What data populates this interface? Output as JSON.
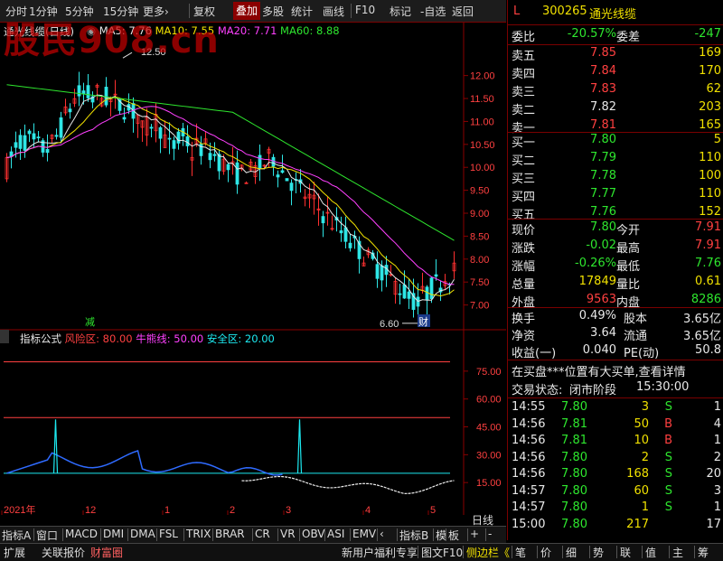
{
  "toolbar": {
    "items": [
      "分时",
      "1分钟",
      "5分钟",
      "15分钟",
      "更多›",
      "复权",
      "叠加",
      "多股",
      "统计",
      "画线",
      "F10",
      "标记",
      "-自选",
      "返回"
    ],
    "active": "叠加"
  },
  "watermark": "股民908.cn",
  "chart": {
    "title": "通光线缆(日线)",
    "ma": [
      {
        "label": "MA5:",
        "value": "7.76",
        "color": "#e8e8e8"
      },
      {
        "label": "MA10:",
        "value": "7.55",
        "color": "#f0e000"
      },
      {
        "label": "MA20:",
        "value": "7.71",
        "color": "#ff40ff"
      },
      {
        "label": "MA60:",
        "value": "8.88",
        "color": "#2ee62e"
      }
    ],
    "high_marker": "12.50",
    "low_marker": "6.60",
    "price_ticks": [
      "12.00",
      "11.50",
      "11.00",
      "10.50",
      "10.00",
      "9.50",
      "9.00",
      "8.50",
      "8.00",
      "7.50",
      "7.00"
    ],
    "reduce_marker": "减",
    "finance_marker": "财"
  },
  "chart_data": {
    "type": "candlestick",
    "price_ylim": [
      6.5,
      12.8
    ],
    "moving_averages": [
      {
        "name": "MA5",
        "value": 7.76
      },
      {
        "name": "MA10",
        "value": 7.55
      },
      {
        "name": "MA20",
        "value": 7.71
      },
      {
        "name": "MA60",
        "value": 8.88
      }
    ],
    "period_high": 12.5,
    "period_low": 6.6,
    "x_labels": [
      "2021年",
      "12",
      "1",
      "2",
      "3",
      "4",
      "5"
    ],
    "indicator": {
      "name": "指标公式",
      "params": [
        {
          "label": "风险区:",
          "value": "80.00"
        },
        {
          "label": "牛熊线:",
          "value": "50.00"
        },
        {
          "label": "安全区:",
          "value": "20.00"
        }
      ],
      "ticks": [
        "75.00",
        "60.00",
        "45.00",
        "30.00",
        "15.00"
      ],
      "ylim": [
        0,
        90
      ]
    }
  },
  "quote": {
    "flag": "L",
    "code": "300265",
    "name": "通光线缆",
    "weibi_label": "委比",
    "weibi": "-20.57%",
    "weicha_label": "委差",
    "weicha": "-247",
    "asks": [
      {
        "label": "卖五",
        "price": "7.85",
        "vol": "169"
      },
      {
        "label": "卖四",
        "price": "7.84",
        "vol": "170"
      },
      {
        "label": "卖三",
        "price": "7.83",
        "vol": "62"
      },
      {
        "label": "卖二",
        "price": "7.82",
        "vol": "203"
      },
      {
        "label": "卖一",
        "price": "7.81",
        "vol": "165"
      }
    ],
    "bids": [
      {
        "label": "买一",
        "price": "7.80",
        "vol": "5"
      },
      {
        "label": "买二",
        "price": "7.79",
        "vol": "110"
      },
      {
        "label": "买三",
        "price": "7.78",
        "vol": "100"
      },
      {
        "label": "买四",
        "price": "7.77",
        "vol": "110"
      },
      {
        "label": "买五",
        "price": "7.76",
        "vol": "152"
      }
    ],
    "stats": [
      {
        "l1": "现价",
        "v1": "7.80",
        "c1": "green",
        "l2": "今开",
        "v2": "7.91",
        "c2": "red"
      },
      {
        "l1": "涨跌",
        "v1": "-0.02",
        "c1": "green",
        "l2": "最高",
        "v2": "7.91",
        "c2": "red"
      },
      {
        "l1": "涨幅",
        "v1": "-0.26%",
        "c1": "green",
        "l2": "最低",
        "v2": "7.76",
        "c2": "green"
      },
      {
        "l1": "总量",
        "v1": "17849",
        "c1": "yellow",
        "l2": "量比",
        "v2": "0.61",
        "c2": "yellow"
      },
      {
        "l1": "外盘",
        "v1": "9563",
        "c1": "red",
        "l2": "内盘",
        "v2": "8286",
        "c2": "green"
      }
    ],
    "stats2": [
      {
        "l1": "换手",
        "v1": "0.49%",
        "l2": "股本",
        "v2": "3.65亿"
      },
      {
        "l1": "净资",
        "v1": "3.64",
        "l2": "流通",
        "v2": "3.65亿"
      },
      {
        "l1": "收益(一)",
        "v1": "0.040",
        "l2": "PE(动)",
        "v2": "50.8"
      }
    ],
    "notice": "在买盘***位置有大买单,查看详情",
    "trade_state_label": "交易状态:",
    "trade_state": "闭市阶段",
    "trade_time": "15:30:00",
    "ticks": [
      {
        "time": "14:55",
        "price": "7.80",
        "vol": "3",
        "bs": "S",
        "n": "1"
      },
      {
        "time": "14:56",
        "price": "7.81",
        "vol": "50",
        "bs": "B",
        "n": "4"
      },
      {
        "time": "14:56",
        "price": "7.81",
        "vol": "10",
        "bs": "B",
        "n": "1"
      },
      {
        "time": "14:56",
        "price": "7.80",
        "vol": "2",
        "bs": "S",
        "n": "2"
      },
      {
        "time": "14:56",
        "price": "7.80",
        "vol": "168",
        "bs": "S",
        "n": "20"
      },
      {
        "time": "14:57",
        "price": "7.80",
        "vol": "60",
        "bs": "S",
        "n": "3"
      },
      {
        "time": "14:57",
        "price": "7.80",
        "vol": "1",
        "bs": "S",
        "n": "1"
      },
      {
        "time": "15:00",
        "price": "7.80",
        "vol": "217",
        "bs": "",
        "n": "17"
      }
    ]
  },
  "indicator_bar": {
    "tabs": [
      "指标A",
      "窗口",
      "MACD",
      "DMI",
      "DMA",
      "FSL",
      "TRIX",
      "BRAR",
      "CR",
      "VR",
      "OBV",
      "ASI",
      "EMV",
      "‹",
      "指标B",
      "模",
      "板",
      "+",
      "-"
    ],
    "period": "日线"
  },
  "bottom_bar": {
    "left": [
      "扩展",
      "关联报价",
      "财富圈"
    ],
    "promo": "新用户福利专享",
    "right_tabs": [
      "图文F10",
      "侧边栏《",
      "笔",
      "价",
      "细",
      "势",
      "联",
      "值",
      "主",
      "筹"
    ]
  }
}
